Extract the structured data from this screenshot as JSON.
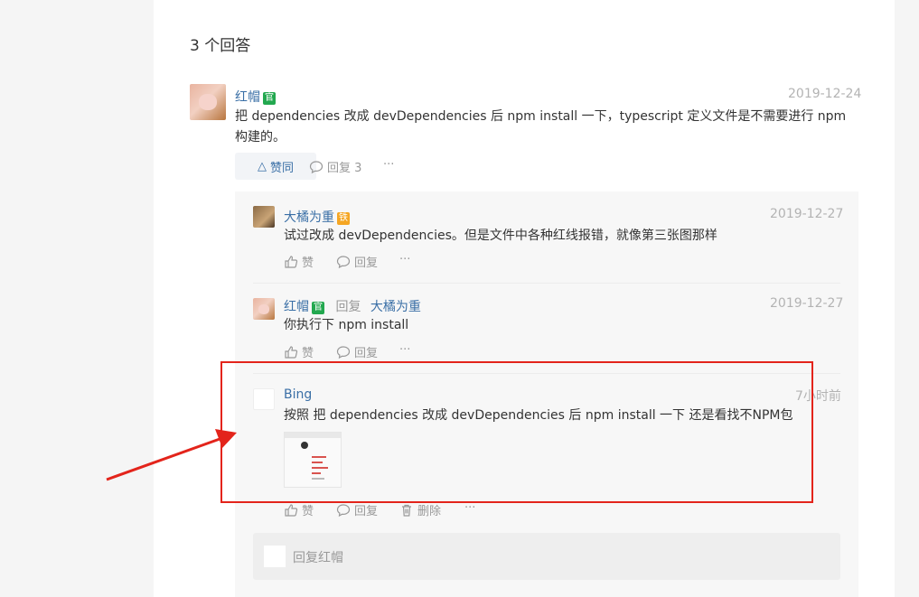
{
  "title": "3 个回答",
  "answer": {
    "user": "红帽",
    "badge": "官",
    "date": "2019-12-24",
    "content": "把 dependencies 改成 devDependencies 后 npm install 一下，typescript 定义文件是不需要进行 npm 构建的。",
    "vote_label": "赞同",
    "reply_label": "回复 3",
    "more": "···"
  },
  "replies": [
    {
      "user": "大橘为重",
      "badge": "铁",
      "date": "2019-12-27",
      "content": "试过改成 devDependencies。但是文件中各种红线报错，就像第三张图那样",
      "like_label": "赞",
      "reply_label": "回复",
      "more": "···"
    },
    {
      "user": "红帽",
      "badge": "官",
      "reply_word": "回复",
      "reply_to": "大橘为重",
      "date": "2019-12-27",
      "content": "你执行下 npm install",
      "like_label": "赞",
      "reply_label": "回复",
      "more": "···"
    },
    {
      "user": "Bing",
      "date": "7小时前",
      "content": "按照 把 dependencies 改成 devDependencies 后 npm install 一下  还是看找不NPM包",
      "like_label": "赞",
      "reply_label": "回复",
      "delete_label": "删除",
      "more": "···"
    }
  ],
  "reply_input": {
    "placeholder": "回复红帽"
  },
  "colors": {
    "link": "#3a6fa6",
    "annotation": "#e3241b",
    "badge_official": "#23a84f",
    "badge_level": "#f5a623"
  }
}
